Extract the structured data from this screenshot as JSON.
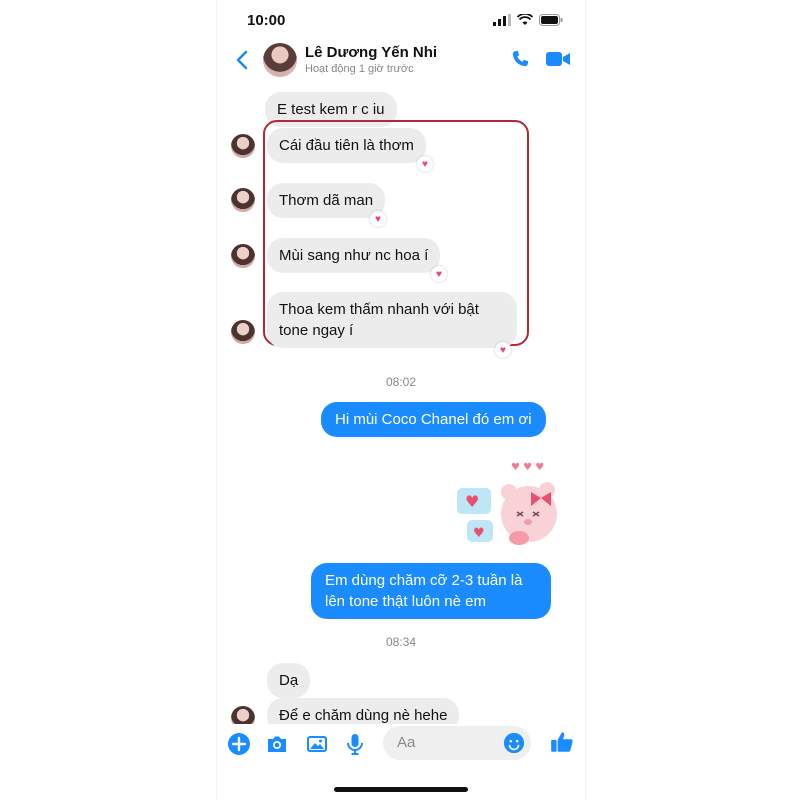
{
  "status": {
    "time": "10:00"
  },
  "header": {
    "name": "Lê Dương Yến Nhi",
    "subtitle": "Hoạt động 1 giờ trước"
  },
  "messages": {
    "m0": "E test kem r c iu",
    "m1": "Cái đầu tiên là thơm",
    "m2": "Thơm dã man",
    "m3": "Mùi sang như nc hoa í",
    "m4": "Thoa kem thấm nhanh với bật tone ngay í",
    "t1": "08:02",
    "m5": "Hi mùi Coco Chanel đó em ơi",
    "m6": "Em dùng chăm cỡ 2-3 tuần là lên tone thật luôn nè em",
    "t2": "08:34",
    "m7": "Dạ",
    "m8": "Để e chăm dùng nè hehe"
  },
  "composer": {
    "placeholder": "Aa"
  },
  "colors": {
    "accent": "#1a8cff",
    "highlight": "#b5283a",
    "reaction": "#f0407a"
  }
}
